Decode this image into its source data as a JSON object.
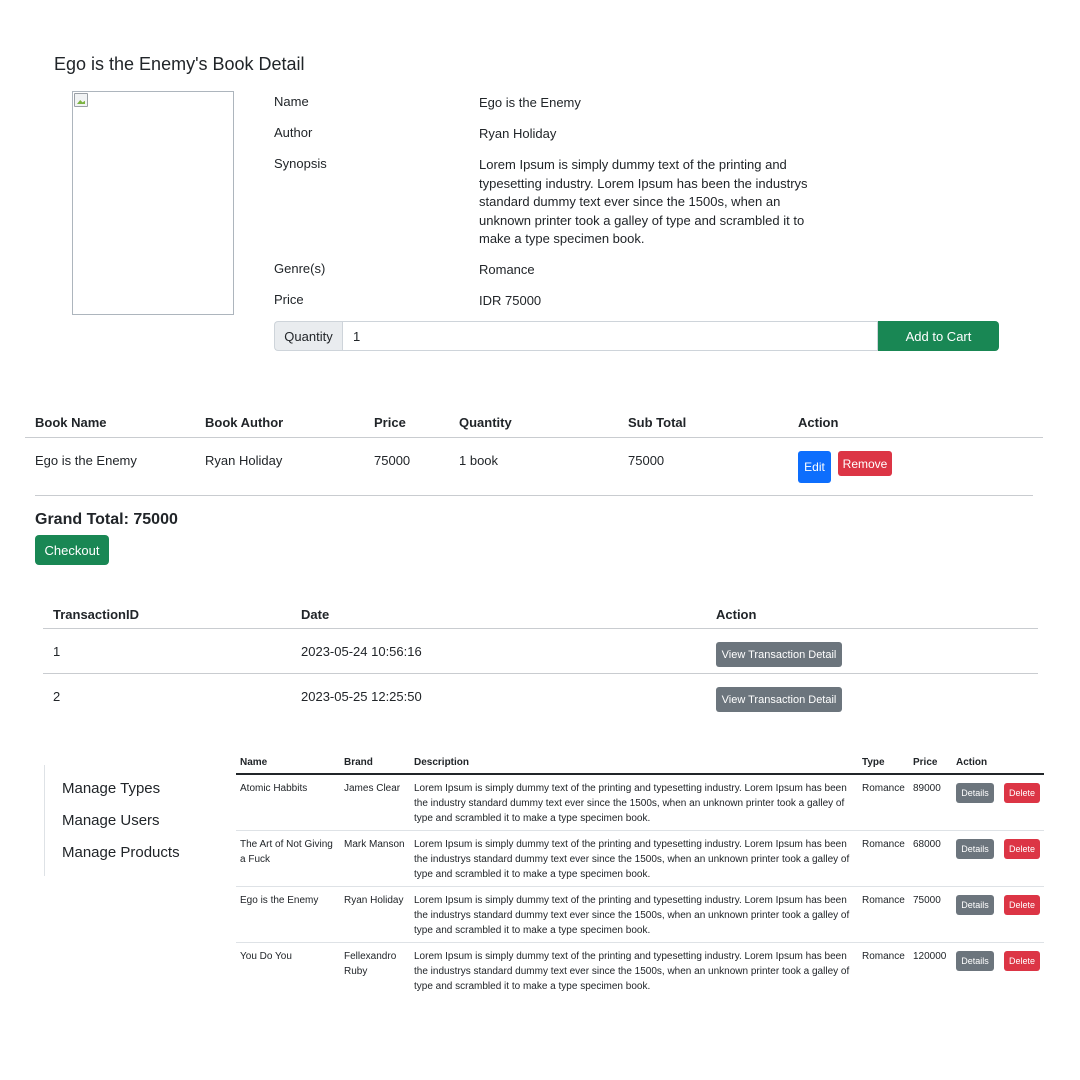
{
  "detail": {
    "title": "Ego is the Enemy's Book Detail",
    "fields": [
      {
        "label": "Name",
        "value": "Ego is the Enemy"
      },
      {
        "label": "Author",
        "value": "Ryan Holiday"
      },
      {
        "label": "Synopsis",
        "value": "Lorem Ipsum is simply dummy text of the printing and typesetting industry. Lorem Ipsum has been the industrys standard dummy text ever since the 1500s, when an unknown printer took a galley of type and scrambled it to make a type specimen book."
      },
      {
        "label": "Genre(s)",
        "value": "Romance"
      },
      {
        "label": "Price",
        "value": "IDR 75000"
      }
    ],
    "quantity_label": "Quantity",
    "quantity_value": "1",
    "add_to_cart_label": "Add to Cart"
  },
  "cart": {
    "headers": [
      "Book Name",
      "Book Author",
      "Price",
      "Quantity",
      "Sub Total",
      "Action"
    ],
    "rows": [
      {
        "name": "Ego is the Enemy",
        "author": "Ryan Holiday",
        "price": "75000",
        "quantity": "1 book",
        "subtotal": "75000",
        "edit_label": "Edit",
        "remove_label": "Remove"
      }
    ],
    "grand_total": "Grand Total: 75000",
    "checkout_label": "Checkout"
  },
  "transactions": {
    "headers": [
      "TransactionID",
      "Date",
      "Action"
    ],
    "rows": [
      {
        "id": "1",
        "date": "2023-05-24 10:56:16",
        "action_label": "View Transaction Detail"
      },
      {
        "id": "2",
        "date": "2023-05-25 12:25:50",
        "action_label": "View Transaction Detail"
      }
    ]
  },
  "sidebar": {
    "items": [
      "Manage Types",
      "Manage Users",
      "Manage Products"
    ]
  },
  "products": {
    "headers": [
      "Name",
      "Brand",
      "Description",
      "Type",
      "Price",
      "Action"
    ],
    "rows": [
      {
        "name": "Atomic Habbits",
        "brand": "James Clear",
        "description": "Lorem Ipsum is simply dummy text of the printing and typesetting industry. Lorem Ipsum has been the industry standard dummy text ever since the 1500s, when an unknown printer took a galley of type and scrambled it to make a type specimen book.",
        "type": "Romance",
        "price": "89000",
        "details_label": "Details",
        "delete_label": "Delete"
      },
      {
        "name": "The Art of Not Giving a Fuck",
        "brand": "Mark Manson",
        "description": "Lorem Ipsum is simply dummy text of the printing and typesetting industry. Lorem Ipsum has been the industrys standard dummy text ever since the 1500s, when an unknown printer took a galley of type and scrambled it to make a type specimen book.",
        "type": "Romance",
        "price": "68000",
        "details_label": "Details",
        "delete_label": "Delete"
      },
      {
        "name": "Ego is the Enemy",
        "brand": "Ryan Holiday",
        "description": "Lorem Ipsum is simply dummy text of the printing and typesetting industry. Lorem Ipsum has been the industrys standard dummy text ever since the 1500s, when an unknown printer took a galley of type and scrambled it to make a type specimen book.",
        "type": "Romance",
        "price": "75000",
        "details_label": "Details",
        "delete_label": "Delete"
      },
      {
        "name": "You Do You",
        "brand": "Fellexandro Ruby",
        "description": "Lorem Ipsum is simply dummy text of the printing and typesetting industry. Lorem Ipsum has been the industrys standard dummy text ever since the 1500s, when an unknown printer took a galley of type and scrambled it to make a type specimen book.",
        "type": "Romance",
        "price": "120000",
        "details_label": "Details",
        "delete_label": "Delete"
      }
    ]
  },
  "colors": {
    "success": "#198754",
    "primary": "#0d6efd",
    "danger": "#dc3545",
    "secondary": "#6c757d",
    "input_group_bg": "#e9ecef"
  },
  "icons": {
    "book_image": "broken-image-icon"
  }
}
